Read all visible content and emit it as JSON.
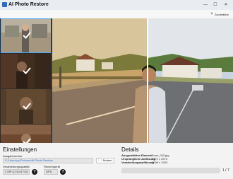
{
  "window": {
    "title": "AI Photo Restore",
    "minimize": "—",
    "maximize": "☐",
    "close": "✕"
  },
  "toolbar": {
    "zoom_label": "Zoomfaktor"
  },
  "thumbnails": [
    {
      "selected": true,
      "checked": true
    },
    {
      "selected": false,
      "checked": true
    },
    {
      "selected": false,
      "checked": true
    },
    {
      "selected": false,
      "checked": true
    }
  ],
  "settings": {
    "heading": "Einstellungen",
    "output_folder_label": "Ausgabeordner",
    "output_folder_value": "C:\\Users\\pc\\Pictures\\AI Photo Restore",
    "change_button": "Ändern",
    "quality_label": "Verarbeitungsqualität",
    "quality_value": "2 MP (1732x1732)",
    "device_label": "Rechengerät",
    "device_value": "GPU"
  },
  "details": {
    "heading": "Details",
    "rows": [
      {
        "key": "Ausgewähltes Element",
        "value": "Scan_003.jpg"
      },
      {
        "key": "Ursprüngliche Auflösung",
        "value": "3472 x 2574"
      },
      {
        "key": "Verarbeitungsauflösung",
        "value": "2098 x 1553"
      }
    ],
    "progress": 0.0,
    "page_indicator": "1 / 7"
  }
}
